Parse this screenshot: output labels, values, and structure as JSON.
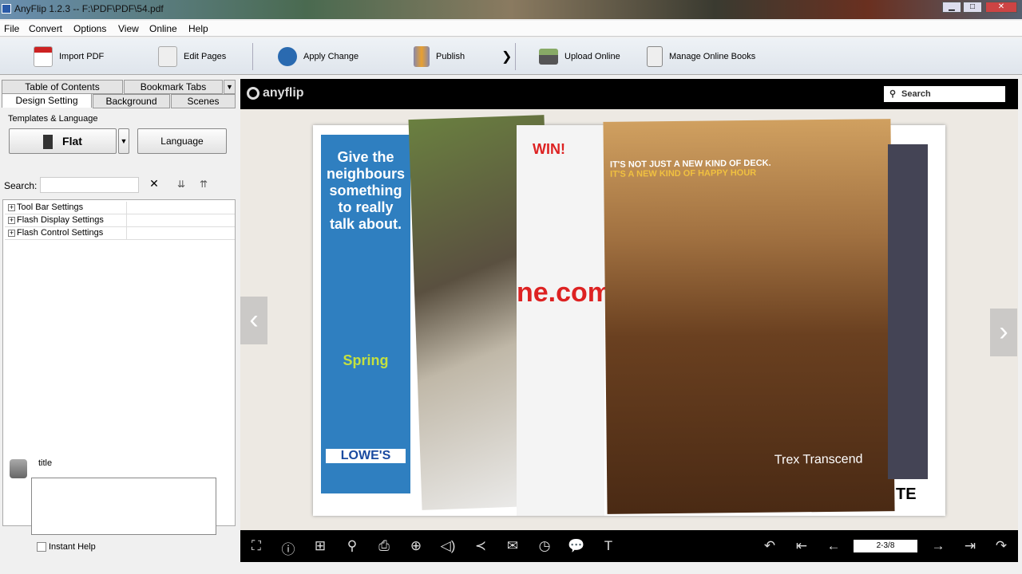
{
  "window": {
    "title": "AnyFlip 1.2.3  -- F:\\PDF\\PDF\\54.pdf",
    "min": "▁",
    "max": "□",
    "close": "✕"
  },
  "menu": [
    "File",
    "Convert",
    "Options",
    "View",
    "Online",
    "Help"
  ],
  "toolbar": {
    "import": "Import PDF",
    "edit": "Edit Pages",
    "apply": "Apply Change",
    "publish": "Publish",
    "more": "❯",
    "upload": "Upload Online",
    "manage": "Manage Online Books"
  },
  "tabs": {
    "toc": "Table of Contents",
    "bookmark": "Bookmark Tabs",
    "design": "Design Setting",
    "background": "Background",
    "scenes": "Scenes"
  },
  "design": {
    "templates_label": "Templates & Language",
    "template": "Flat",
    "language": "Language",
    "search_label": "Search:",
    "search_value": "",
    "tree": [
      "Tool Bar Settings",
      "Flash Display Settings",
      "Flash Control Settings"
    ]
  },
  "help": {
    "title": "title",
    "instant_help": "Instant Help"
  },
  "viewer": {
    "logo": "anyflip",
    "search": "Search",
    "page": "2-3/8",
    "page_texts": {
      "ad1": "Give the neighbours something to really talk about.",
      "spring": "Spring",
      "lowes": "LOWE'S",
      "win": "WIN!",
      "deck1": "IT'S NOT JUST A NEW KIND OF DECK.",
      "deck2": "IT'S A NEW KIND OF HAPPY HOUR",
      "trex": "Trex Transcend",
      "com": "ne.com",
      "te": "TE"
    }
  },
  "colors": {
    "viewer_bg": "#ede9e3",
    "bar": "#000000",
    "accent": "#2a6ab0"
  }
}
